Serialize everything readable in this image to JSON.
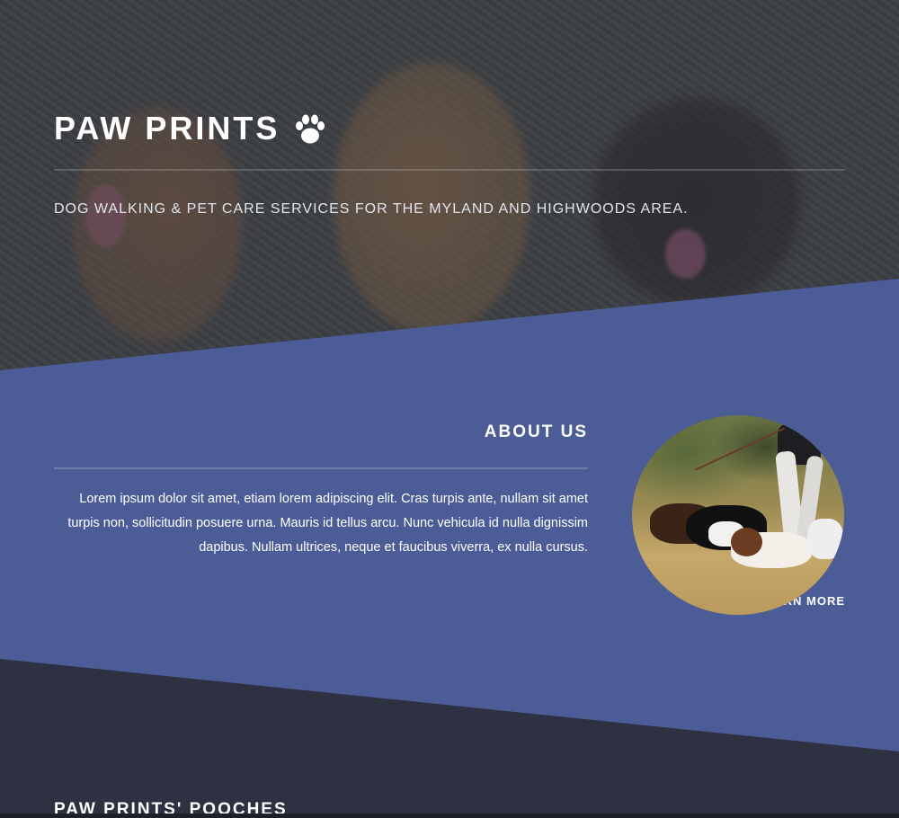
{
  "hero": {
    "title": "PAW PRINTS",
    "title_icon": "paw-icon",
    "tagline": "DOG WALKING & PET CARE SERVICES FOR THE MYLAND AND HIGHWOODS AREA."
  },
  "about": {
    "title": "ABOUT US",
    "body": "Lorem ipsum dolor sit amet, etiam lorem adipiscing elit. Cras turpis ante, nullam sit amet turpis non, sollicitudin posuere urna. Mauris id tellus arcu. Nunc vehicula id nulla dignissim dapibus. Nullam ultrices, neque et faucibus viverra, ex nulla cursus.",
    "learn_more_label": "LEARN MORE",
    "learn_more_icon": "chevron-right-icon"
  },
  "pooches": {
    "title": "PAW PRINTS' POOCHES"
  },
  "colors": {
    "accent": "#4c5c96",
    "dark": "#2e3141",
    "text": "#ffffff"
  }
}
